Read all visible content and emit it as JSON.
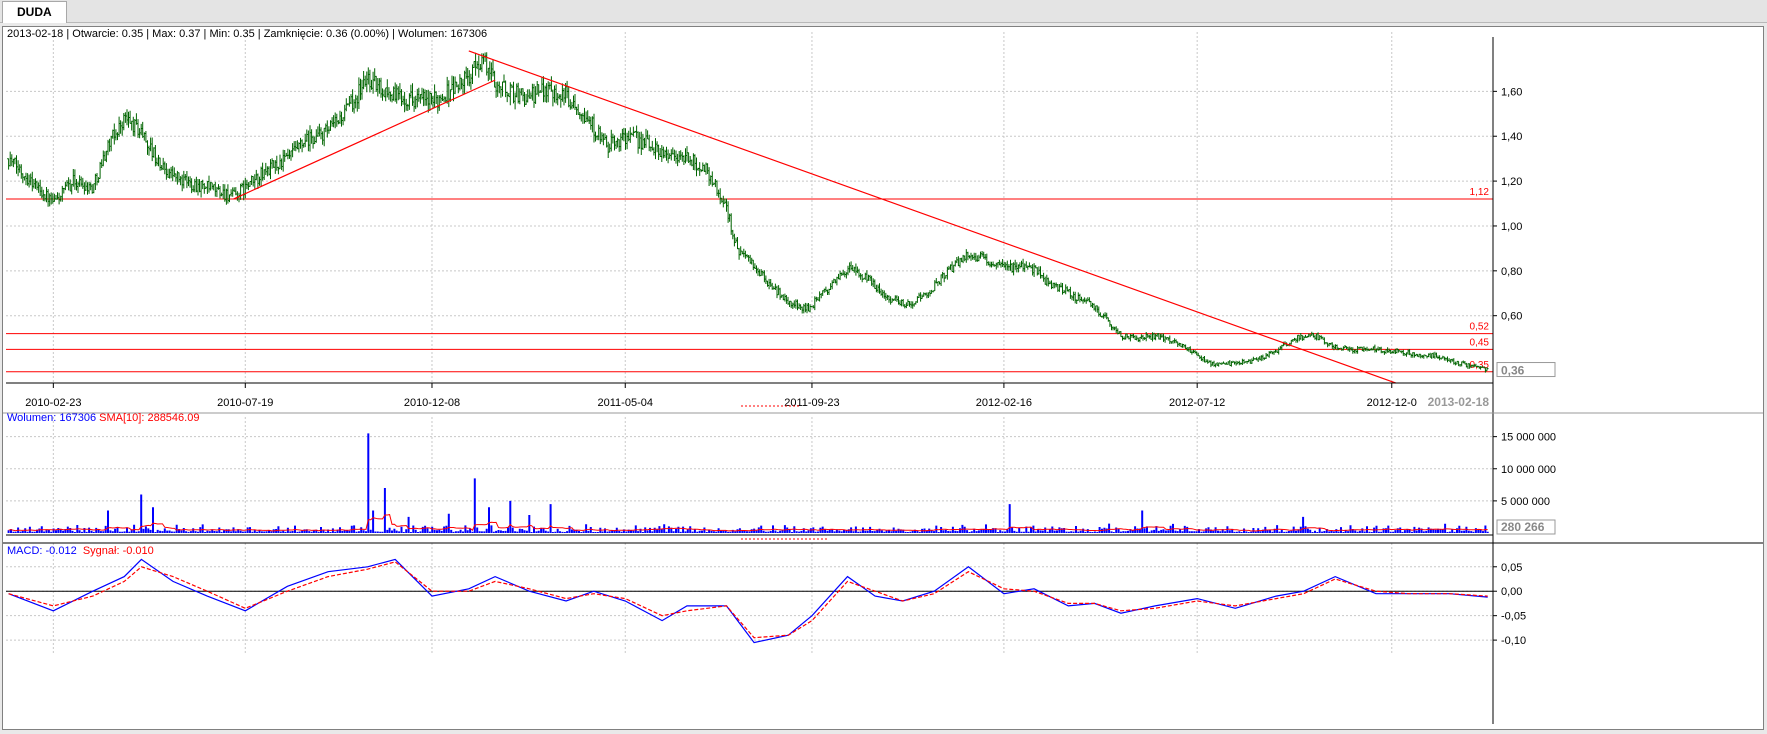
{
  "tab": {
    "label": "DUDA"
  },
  "header": {
    "date": "2013-02-18",
    "open": "Otwarcie: 0.35",
    "high": "Max: 0.37",
    "low": "Min: 0.35",
    "close": "Zamknięcie: 0.36 (0.00%)",
    "volume": "Wolumen: 167306"
  },
  "volume_panel": {
    "label": "Wolumen: 167306",
    "sma_label": "SMA[10]: 288546.09",
    "last_value": "280 266"
  },
  "macd_panel": {
    "macd_label": "MACD: -0.012",
    "signal_label": "Sygnał: -0.010"
  },
  "colors": {
    "candle": "#006400",
    "trendline": "#ff0000",
    "volume": "#0000ff",
    "sma": "#ff0000",
    "macd": "#0000ff",
    "signal": "#ff0000",
    "grid": "#c8c8c8"
  },
  "chart_data": [
    {
      "type": "line",
      "chart": "price-ohlc",
      "x_tick_labels": [
        "2010-02-23",
        "2010-07-19",
        "2010-12-08",
        "2011-05-04",
        "2011-09-23",
        "2012-02-16",
        "2012-07-12",
        "2012-12-0"
      ],
      "x_end_label": "2013-02-18",
      "y_tick_labels": [
        "0,60",
        "0,80",
        "1,00",
        "1,20",
        "1,40",
        "1,60"
      ],
      "ylim": [
        0.3,
        1.82
      ],
      "last_price_label": "0,36",
      "hlines": [
        {
          "value": 1.12,
          "label": "1,12"
        },
        {
          "value": 0.52,
          "label": "0,52"
        },
        {
          "value": 0.45,
          "label": "0,45"
        },
        {
          "value": 0.35,
          "label": "0,35"
        }
      ],
      "trendlines": [
        {
          "from": [
            "2010-07-10",
            1.12
          ],
          "to": [
            "2011-01-25",
            1.65
          ]
        },
        {
          "from": [
            "2011-01-05",
            1.78
          ],
          "to": [
            "2012-12-10",
            0.3
          ]
        }
      ],
      "series": [
        {
          "x": [
            "2010-01-20",
            "2010-02-10",
            "2010-02-23",
            "2010-03-10",
            "2010-03-25",
            "2010-04-05",
            "2010-04-18",
            "2010-05-01",
            "2010-05-15",
            "2010-06-01",
            "2010-06-15",
            "2010-07-01",
            "2010-07-10",
            "2010-07-19",
            "2010-08-05",
            "2010-08-20",
            "2010-09-05",
            "2010-09-20",
            "2010-10-05",
            "2010-10-20",
            "2010-10-28",
            "2010-11-10",
            "2010-11-25",
            "2010-12-08",
            "2010-12-20",
            "2011-01-05",
            "2011-01-15",
            "2011-01-25",
            "2011-02-05",
            "2011-02-20",
            "2011-03-05",
            "2011-03-20",
            "2011-04-01",
            "2011-04-20",
            "2011-05-04",
            "2011-05-20",
            "2011-06-05",
            "2011-06-20",
            "2011-07-05",
            "2011-07-20",
            "2011-07-28",
            "2011-08-05",
            "2011-08-20",
            "2011-09-05",
            "2011-09-20",
            "2011-10-05",
            "2011-10-20",
            "2011-11-05",
            "2011-11-20",
            "2011-12-05",
            "2011-12-20",
            "2012-01-05",
            "2012-01-20",
            "2012-02-05",
            "2012-02-16",
            "2012-03-05",
            "2012-03-20",
            "2012-04-05",
            "2012-04-20",
            "2012-05-05",
            "2012-05-15",
            "2012-05-25",
            "2012-06-10",
            "2012-06-25",
            "2012-07-12",
            "2012-07-25",
            "2012-08-10",
            "2012-08-25",
            "2012-09-10",
            "2012-09-25",
            "2012-10-10",
            "2012-10-25",
            "2012-11-10",
            "2012-11-25",
            "2012-12-10",
            "2012-12-25",
            "2013-01-10",
            "2013-01-25",
            "2013-02-18"
          ],
          "y": [
            1.3,
            1.18,
            1.1,
            1.2,
            1.17,
            1.35,
            1.48,
            1.42,
            1.27,
            1.2,
            1.18,
            1.15,
            1.13,
            1.17,
            1.25,
            1.3,
            1.38,
            1.42,
            1.52,
            1.66,
            1.62,
            1.58,
            1.57,
            1.55,
            1.6,
            1.66,
            1.75,
            1.64,
            1.6,
            1.57,
            1.62,
            1.58,
            1.52,
            1.35,
            1.4,
            1.37,
            1.32,
            1.3,
            1.25,
            1.08,
            0.9,
            0.85,
            0.75,
            0.66,
            0.63,
            0.72,
            0.81,
            0.76,
            0.68,
            0.65,
            0.7,
            0.8,
            0.88,
            0.84,
            0.81,
            0.83,
            0.75,
            0.7,
            0.66,
            0.58,
            0.51,
            0.5,
            0.51,
            0.49,
            0.42,
            0.38,
            0.39,
            0.4,
            0.44,
            0.5,
            0.51,
            0.46,
            0.45,
            0.45,
            0.44,
            0.43,
            0.42,
            0.39,
            0.36
          ]
        }
      ]
    },
    {
      "type": "bar",
      "chart": "volume",
      "y_tick_labels": [
        "5 000 000",
        "10 000 000",
        "15 000 000"
      ],
      "ylim": [
        0,
        16500000
      ],
      "spikes": [
        {
          "x": "2010-02-23",
          "value": 700000
        },
        {
          "x": "2010-04-05",
          "value": 3500000
        },
        {
          "x": "2010-05-01",
          "value": 6000000
        },
        {
          "x": "2010-05-10",
          "value": 4000000
        },
        {
          "x": "2010-10-20",
          "value": 15500000
        },
        {
          "x": "2010-10-25",
          "value": 3500000
        },
        {
          "x": "2010-11-03",
          "value": 7000000
        },
        {
          "x": "2010-11-20",
          "value": 2500000
        },
        {
          "x": "2010-12-20",
          "value": 3000000
        },
        {
          "x": "2011-01-10",
          "value": 8500000
        },
        {
          "x": "2011-01-20",
          "value": 4000000
        },
        {
          "x": "2011-02-05",
          "value": 5000000
        },
        {
          "x": "2011-02-20",
          "value": 2800000
        },
        {
          "x": "2011-03-08",
          "value": 4500000
        },
        {
          "x": "2012-02-20",
          "value": 4500000
        },
        {
          "x": "2012-06-01",
          "value": 3500000
        },
        {
          "x": "2012-10-01",
          "value": 2500000
        }
      ],
      "sma_label": "SMA[10]"
    },
    {
      "type": "line",
      "chart": "macd",
      "y_tick_labels": [
        "-0,10",
        "-0,05",
        "0,00",
        "0,05"
      ],
      "ylim": [
        -0.11,
        0.07
      ],
      "series": [
        {
          "name": "MACD",
          "x": [
            "2010-01-20",
            "2010-02-23",
            "2010-03-25",
            "2010-04-18",
            "2010-05-01",
            "2010-05-25",
            "2010-06-20",
            "2010-07-19",
            "2010-08-20",
            "2010-09-20",
            "2010-10-20",
            "2010-11-10",
            "2010-12-08",
            "2011-01-05",
            "2011-01-25",
            "2011-02-20",
            "2011-03-20",
            "2011-04-10",
            "2011-05-04",
            "2011-06-01",
            "2011-06-20",
            "2011-07-20",
            "2011-08-10",
            "2011-09-05",
            "2011-09-23",
            "2011-10-20",
            "2011-11-10",
            "2011-12-01",
            "2011-12-25",
            "2012-01-20",
            "2012-02-16",
            "2012-03-10",
            "2012-04-05",
            "2012-04-25",
            "2012-05-15",
            "2012-06-10",
            "2012-07-12",
            "2012-08-10",
            "2012-09-10",
            "2012-10-01",
            "2012-10-25",
            "2012-11-25",
            "2012-12-20",
            "2013-01-20",
            "2013-02-18"
          ],
          "y": [
            -0.005,
            -0.04,
            0.0,
            0.03,
            0.065,
            0.02,
            -0.01,
            -0.04,
            0.01,
            0.04,
            0.05,
            0.065,
            -0.01,
            0.005,
            0.03,
            0.0,
            -0.02,
            0.0,
            -0.02,
            -0.06,
            -0.03,
            -0.03,
            -0.105,
            -0.09,
            -0.05,
            0.03,
            -0.01,
            -0.02,
            0.0,
            0.05,
            -0.005,
            0.005,
            -0.03,
            -0.025,
            -0.045,
            -0.03,
            -0.015,
            -0.035,
            -0.01,
            0.0,
            0.03,
            -0.005,
            -0.005,
            -0.005,
            -0.012
          ]
        },
        {
          "name": "Sygnał",
          "x": [
            "2010-01-20",
            "2010-02-23",
            "2010-03-25",
            "2010-04-18",
            "2010-05-01",
            "2010-05-25",
            "2010-06-20",
            "2010-07-19",
            "2010-08-20",
            "2010-09-20",
            "2010-10-20",
            "2010-11-10",
            "2010-12-08",
            "2011-01-05",
            "2011-01-25",
            "2011-02-20",
            "2011-03-20",
            "2011-04-10",
            "2011-05-04",
            "2011-06-01",
            "2011-06-20",
            "2011-07-20",
            "2011-08-10",
            "2011-09-05",
            "2011-09-23",
            "2011-10-20",
            "2011-11-10",
            "2011-12-01",
            "2011-12-25",
            "2012-01-20",
            "2012-02-16",
            "2012-03-10",
            "2012-04-05",
            "2012-04-25",
            "2012-05-15",
            "2012-06-10",
            "2012-07-12",
            "2012-08-10",
            "2012-09-10",
            "2012-10-01",
            "2012-10-25",
            "2012-11-25",
            "2012-12-20",
            "2013-01-20",
            "2013-02-18"
          ],
          "y": [
            -0.005,
            -0.03,
            -0.01,
            0.02,
            0.05,
            0.03,
            0.0,
            -0.035,
            0.0,
            0.03,
            0.045,
            0.06,
            0.0,
            0.0,
            0.02,
            0.005,
            -0.015,
            -0.005,
            -0.015,
            -0.05,
            -0.04,
            -0.03,
            -0.095,
            -0.09,
            -0.06,
            0.02,
            0.0,
            -0.02,
            -0.005,
            0.04,
            0.005,
            0.0,
            -0.025,
            -0.025,
            -0.04,
            -0.035,
            -0.02,
            -0.03,
            -0.015,
            -0.005,
            0.025,
            0.0,
            -0.005,
            -0.005,
            -0.01
          ]
        }
      ],
      "zero_line": 0.0
    }
  ]
}
